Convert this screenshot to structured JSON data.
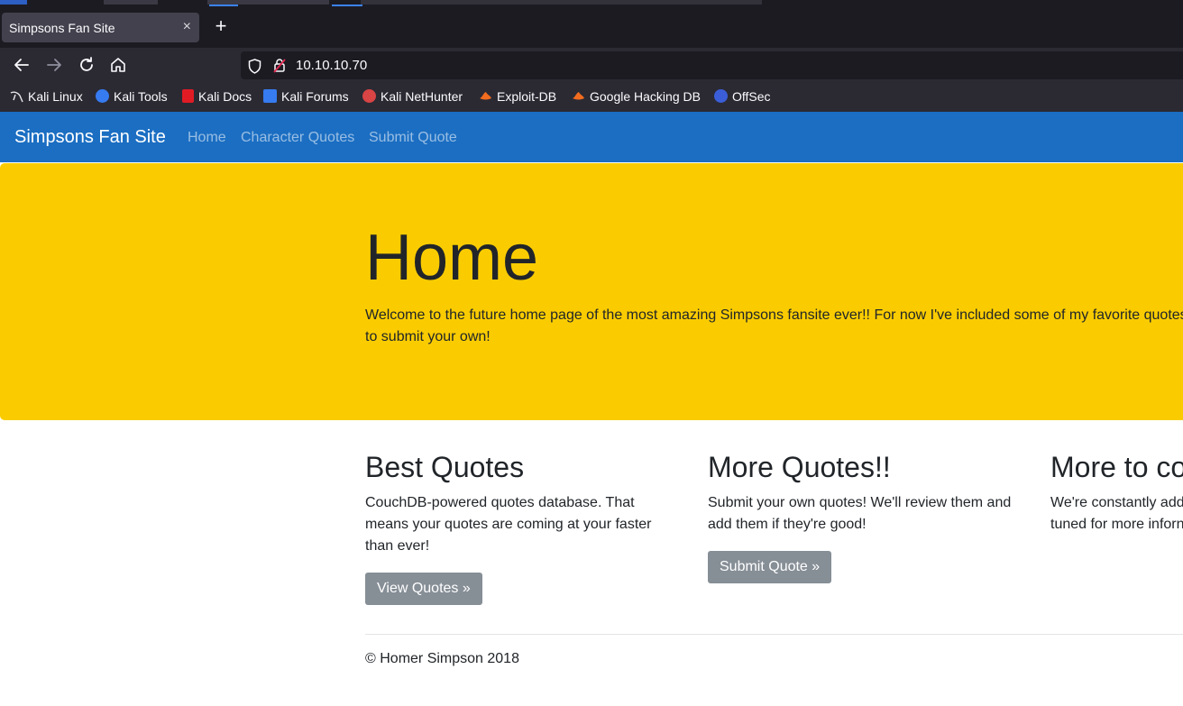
{
  "browser": {
    "tab_title": "Simpsons Fan Site",
    "tab_close": "×",
    "new_tab": "+",
    "url": "10.10.10.70",
    "bookmarks": [
      {
        "label": "Kali Linux",
        "icon": "kali-dragon-icon",
        "color": "#e8e8ea"
      },
      {
        "label": "Kali Tools",
        "icon": "kali-tools-icon",
        "color": "#367bf0"
      },
      {
        "label": "Kali Docs",
        "icon": "kali-docs-icon",
        "color": "#e01b24"
      },
      {
        "label": "Kali Forums",
        "icon": "kali-forums-icon",
        "color": "#367bf0"
      },
      {
        "label": "Kali NetHunter",
        "icon": "nethunter-icon",
        "color": "#d94444"
      },
      {
        "label": "Exploit-DB",
        "icon": "exploit-db-icon",
        "color": "#f26c1f"
      },
      {
        "label": "Google Hacking DB",
        "icon": "ghdb-icon",
        "color": "#f26c1f"
      },
      {
        "label": "OffSec",
        "icon": "offsec-icon",
        "color": "#3b5ed8"
      }
    ]
  },
  "site": {
    "brand": "Simpsons Fan Site",
    "nav": [
      "Home",
      "Character Quotes",
      "Submit Quote"
    ],
    "hero": {
      "title": "Home",
      "text_line1": "Welcome to the future home page of the most amazing Simpsons fansite ever!! For now I've included some of my favorite quotes",
      "text_line2": "to submit your own!"
    },
    "columns": [
      {
        "heading": "Best Quotes",
        "lines": [
          "CouchDB-powered quotes database. That",
          "means your quotes are coming at your faster",
          "than ever!"
        ],
        "button": "View Quotes »"
      },
      {
        "heading": "More Quotes!!",
        "lines": [
          "Submit your own quotes! We'll review them and",
          "add them if they're good!"
        ],
        "button": "Submit Quote »"
      },
      {
        "heading": "More to co",
        "lines": [
          "We're constantly add",
          "tuned for more inforn"
        ],
        "button": ""
      }
    ],
    "footer": "© Homer Simpson 2018"
  },
  "colors": {
    "navbar": "#1b6ec2",
    "jumbotron": "#facc00",
    "button": "#868e96",
    "text": "#212529"
  }
}
